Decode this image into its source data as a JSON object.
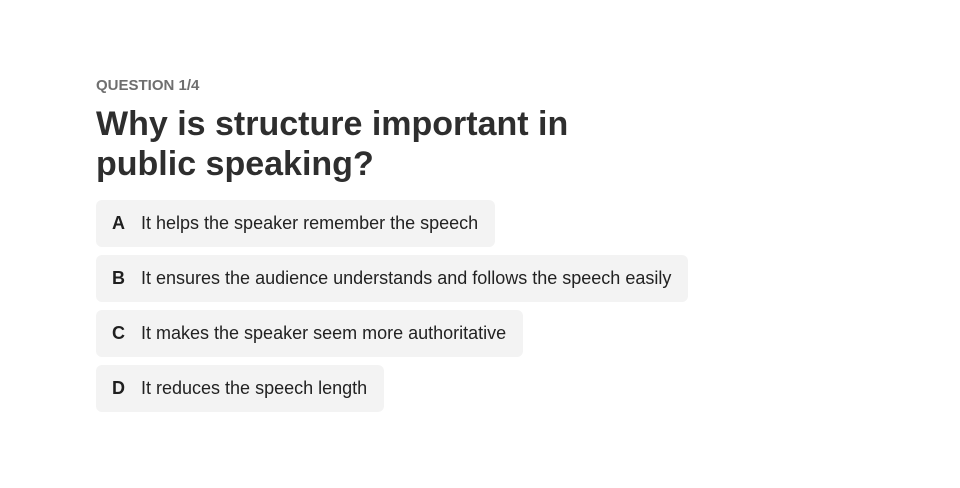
{
  "quiz": {
    "counter": "QUESTION 1/4",
    "question": "Why is structure important in public speaking?",
    "options": [
      {
        "letter": "A",
        "text": "It helps the speaker remember the speech"
      },
      {
        "letter": "B",
        "text": "It ensures the audience understands and follows the speech easily"
      },
      {
        "letter": "C",
        "text": "It makes the speaker seem more authoritative"
      },
      {
        "letter": "D",
        "text": "It reduces the speech length"
      }
    ]
  },
  "colors": {
    "background": "#ffffff",
    "option_background": "#f3f3f3",
    "heading": "#2e2e2e",
    "counter": "#6f6f6f"
  }
}
